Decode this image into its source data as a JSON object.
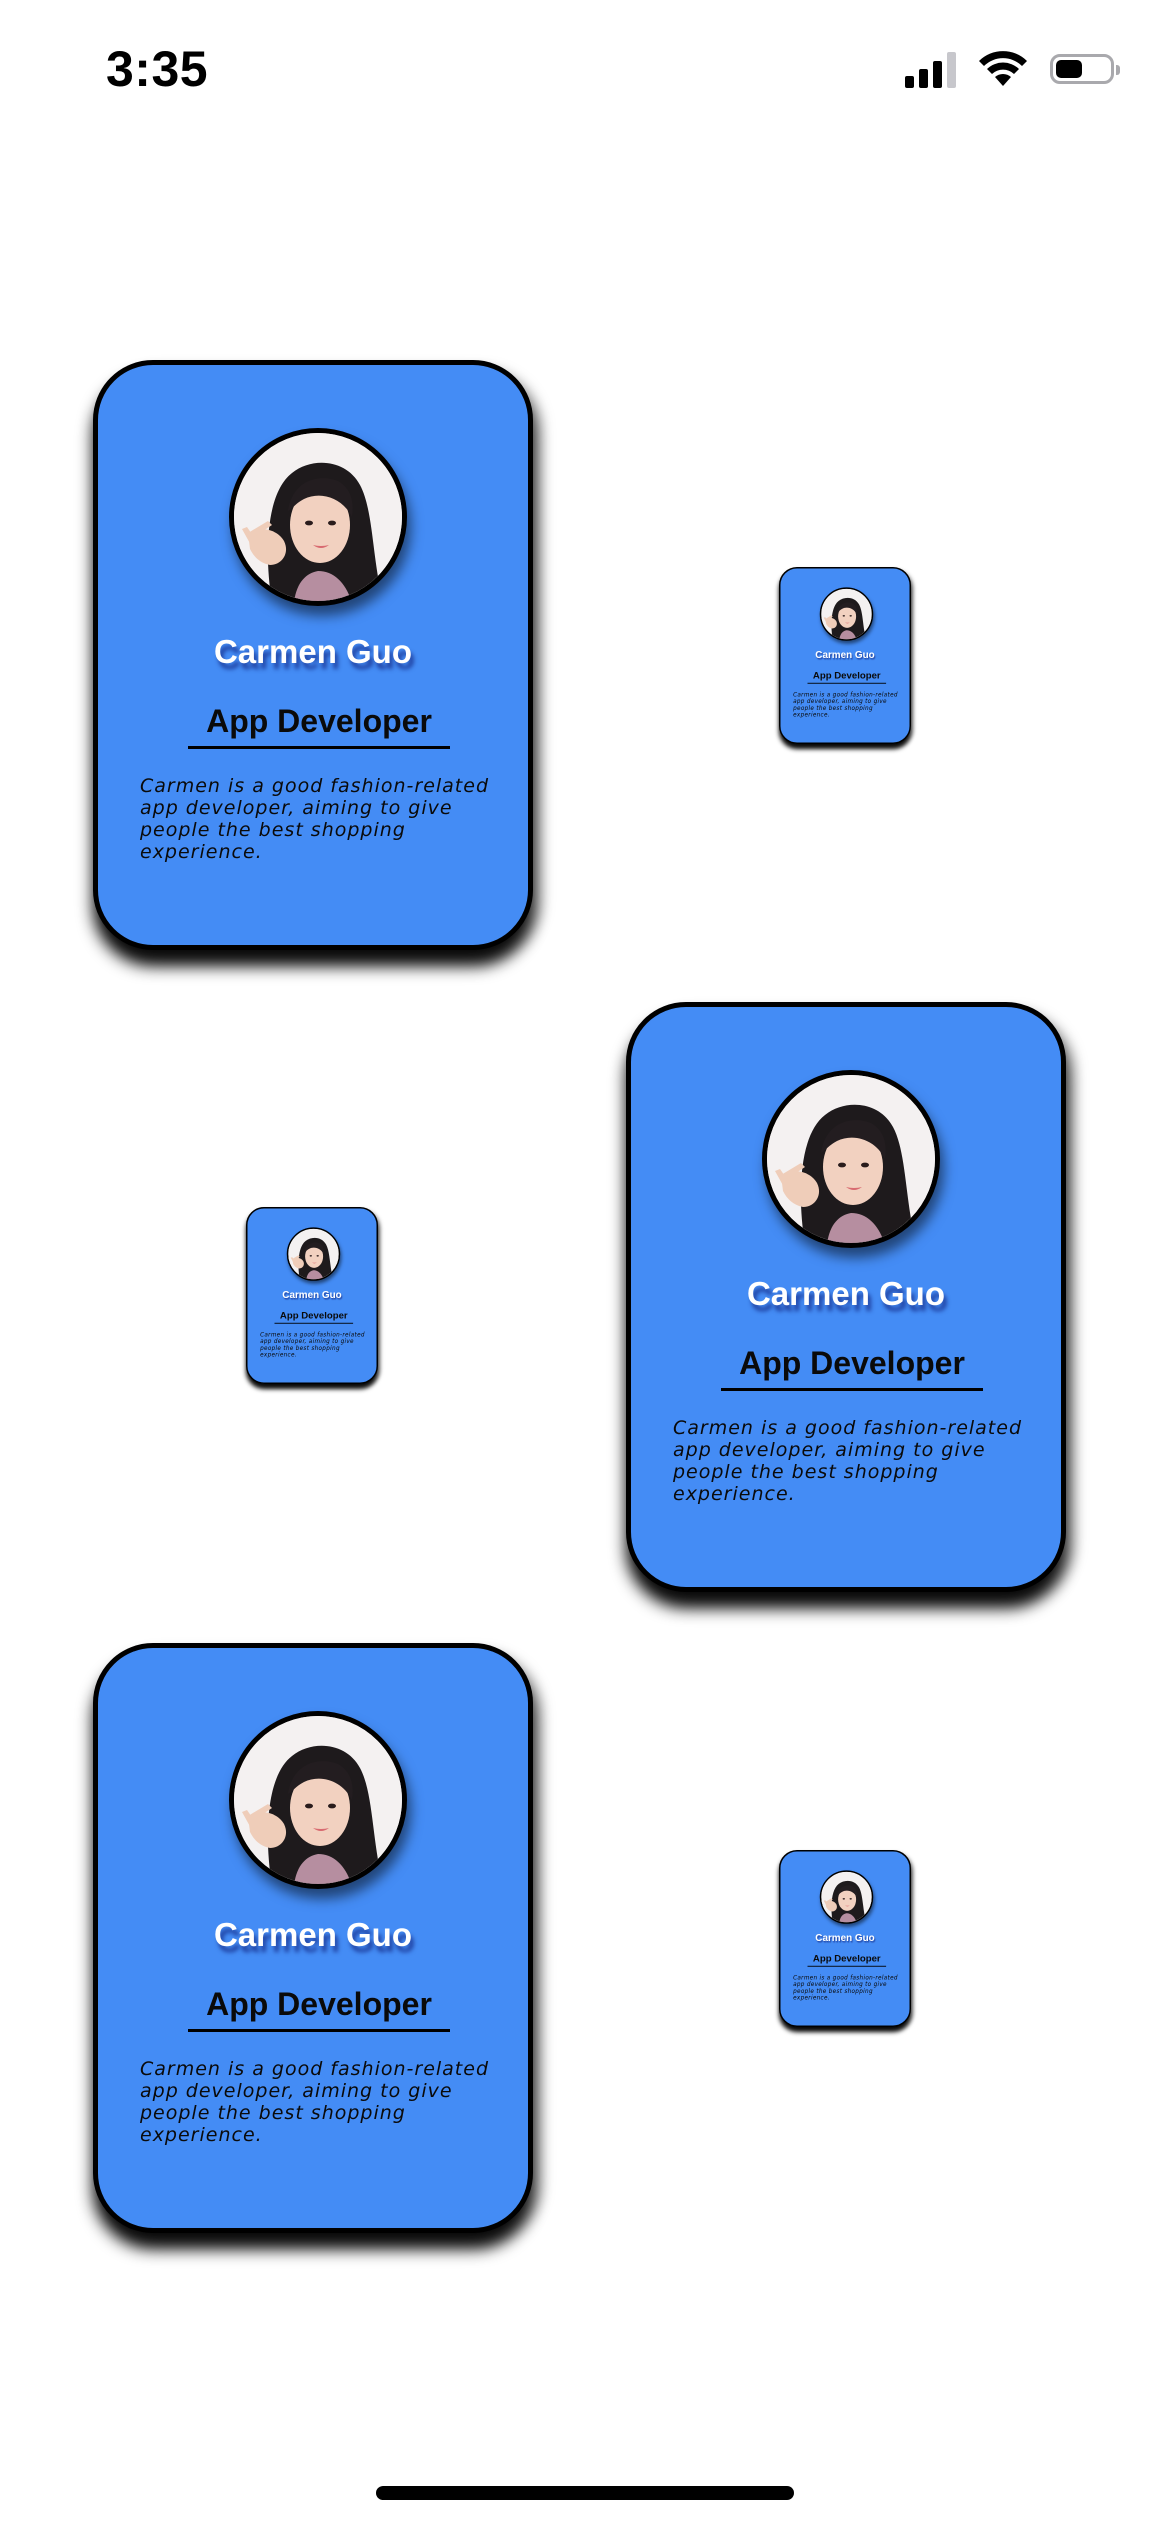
{
  "status_bar": {
    "time": "3:35",
    "icons": [
      "signal-icon",
      "wifi-icon",
      "battery-icon"
    ]
  },
  "profile": {
    "name": "Carmen Guo",
    "role": "App Developer",
    "bio": "Carmen is a good fashion-related app developer, aiming to give people the best shopping experience.",
    "avatar_icon": "profile-photo"
  },
  "cards": [
    {
      "size": "large"
    },
    {
      "size": "small"
    },
    {
      "size": "small"
    },
    {
      "size": "large"
    },
    {
      "size": "large"
    },
    {
      "size": "small"
    }
  ],
  "colors": {
    "card_background": "#448cf5",
    "card_border": "#000000",
    "name_text": "#ffffff",
    "page_background": "#ffffff"
  }
}
